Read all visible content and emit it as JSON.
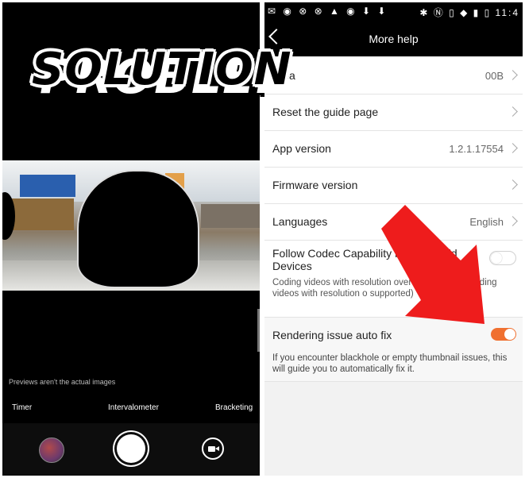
{
  "left_panel": {
    "title": "PROBLEM",
    "preview_note": "Previews aren't the actual images",
    "modes": [
      "Timer",
      "Intervalometer",
      "Bracketing"
    ]
  },
  "right_panel": {
    "title_overlay": "SOLUTION",
    "status_time": "11:4",
    "nav_title": "More help",
    "rows": {
      "clear_label": "Clea",
      "clear_value": "00B",
      "reset_label": "Reset the guide page",
      "app_version_label": "App version",
      "app_version_value": "1.2.1.17554",
      "firmware_label": "Firmware version",
      "languages_label": "Languages",
      "languages_value": "English",
      "codec_label": "Follow Codec Capability         nt fo Android Devices",
      "codec_desc": "Coding videos with resolution over                    upported); Decoding videos with resolution o supported)",
      "render_label": "Rendering issue auto fix",
      "render_desc": "If you encounter blackhole or empty thumbnail issues, this will guide you to automatically fix it."
    },
    "toggles": {
      "codec_on": false,
      "render_on": true
    },
    "accent_color": "#f07030",
    "arrow_color": "#ee1c1c"
  }
}
